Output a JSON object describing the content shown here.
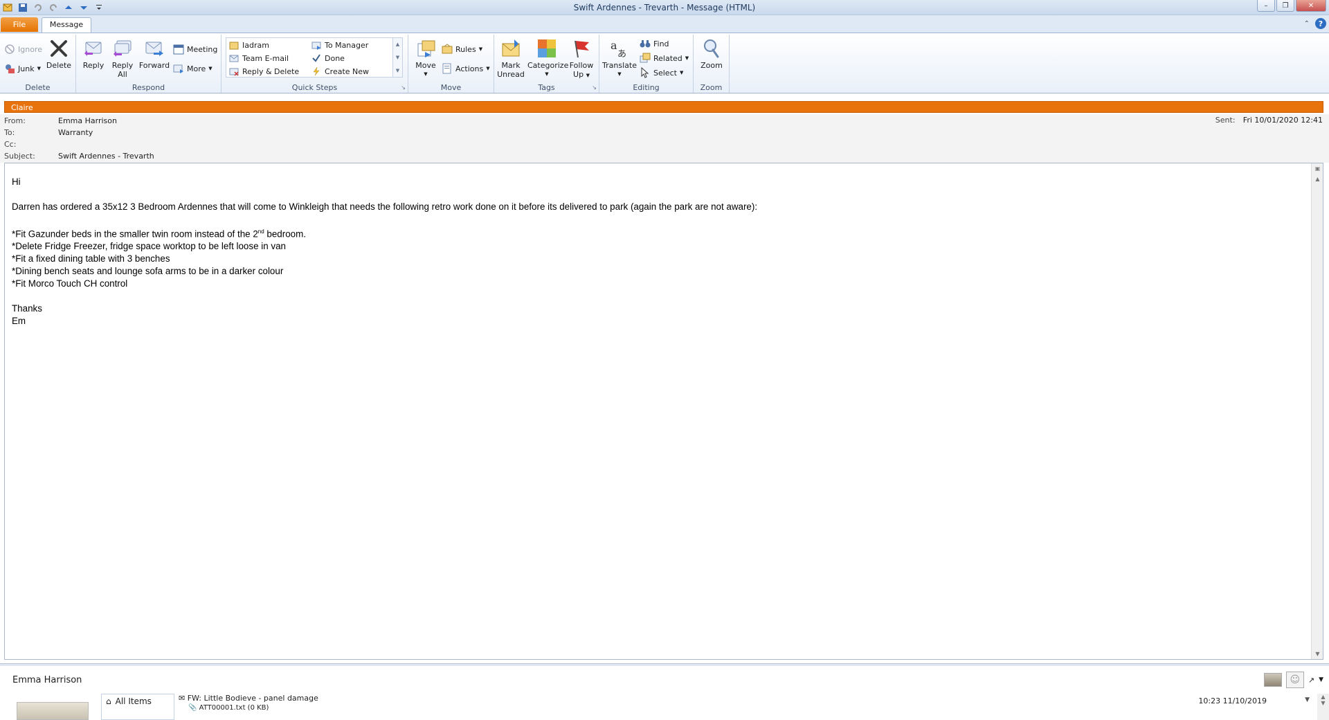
{
  "window": {
    "title": "Swift Ardennes - Trevarth  -  Message (HTML)"
  },
  "tabs": {
    "file": "File",
    "message": "Message"
  },
  "ribbon": {
    "delete_group": {
      "label": "Delete",
      "ignore": "Ignore",
      "junk": "Junk",
      "delete": "Delete"
    },
    "respond_group": {
      "label": "Respond",
      "reply": "Reply",
      "reply_all_1": "Reply",
      "reply_all_2": "All",
      "forward": "Forward",
      "meeting": "Meeting",
      "more": "More"
    },
    "quicksteps_group": {
      "label": "Quick Steps",
      "items": [
        "Iadram",
        "To Manager",
        "Team E-mail",
        "Done",
        "Reply & Delete",
        "Create New"
      ]
    },
    "move_group": {
      "label": "Move",
      "move": "Move",
      "rules": "Rules",
      "actions": "Actions"
    },
    "tags_group": {
      "label": "Tags",
      "mark_unread_1": "Mark",
      "mark_unread_2": "Unread",
      "categorize": "Categorize",
      "follow_up_1": "Follow",
      "follow_up_2": "Up"
    },
    "editing_group": {
      "label": "Editing",
      "translate": "Translate",
      "find": "Find",
      "related": "Related",
      "select": "Select"
    },
    "zoom_group": {
      "label": "Zoom",
      "zoom": "Zoom"
    }
  },
  "infobar": {
    "text": "Claire"
  },
  "header": {
    "from_label": "From:",
    "from": "Emma Harrison",
    "to_label": "To:",
    "to": "Warranty",
    "cc_label": "Cc:",
    "cc": "",
    "subject_label": "Subject:",
    "subject": "Swift Ardennes - Trevarth",
    "sent_label": "Sent:",
    "sent": "Fri 10/01/2020 12:41"
  },
  "body": {
    "greeting": "Hi",
    "intro": "Darren has ordered a 35x12 3 Bedroom Ardennes that will come to Winkleigh that needs the following retro work done on it before its delivered to park (again the park are not aware):",
    "bullet1_pre": "*Fit Gazunder beds in the smaller twin room instead of the 2",
    "bullet1_sup": "nd",
    "bullet1_post": " bedroom.",
    "bullet2": "*Delete Fridge Freezer, fridge space worktop to be left loose in van",
    "bullet3": "*Fit a fixed dining table with 3 benches",
    "bullet4": "*Dining bench seats and lounge sofa arms to be in a darker colour",
    "bullet5": "*Fit Morco Touch CH control",
    "thanks": "Thanks",
    "signature": "Em"
  },
  "people_pane": {
    "name": "Emma Harrison",
    "all_items": "All Items",
    "item_subject": "FW: Little Bodieve - panel damage",
    "item_attachment": "ATT00001.txt (0 KB)",
    "item_date": "10:23  11/10/2019"
  },
  "colors": {
    "accent": "#e8730c",
    "ribbon_bg": "#e9f0f9",
    "titlebar": "#c9d9ee"
  }
}
